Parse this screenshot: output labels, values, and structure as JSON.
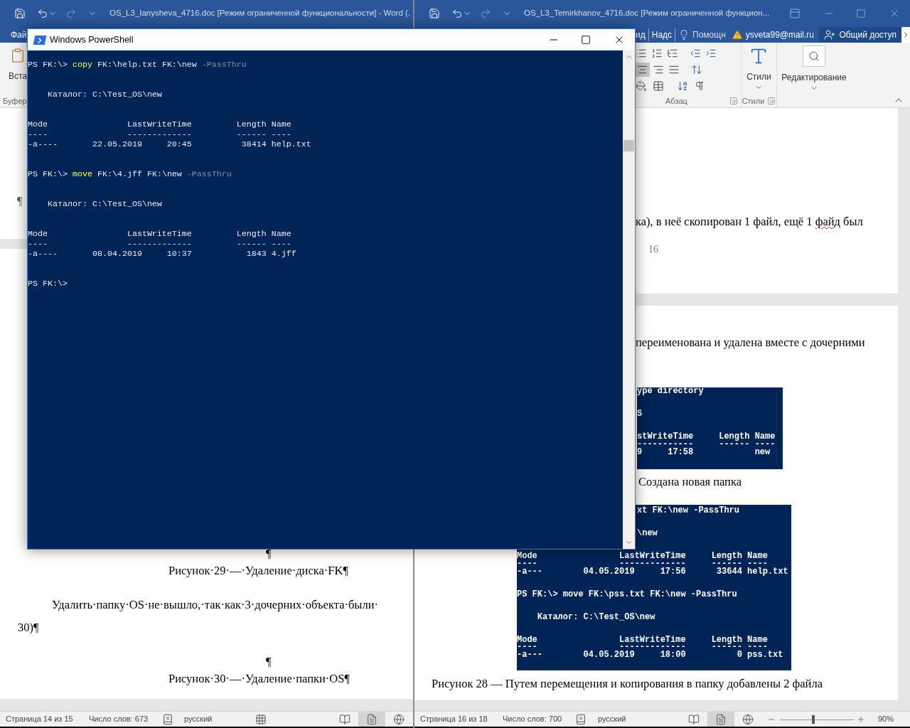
{
  "left_window": {
    "title": "OS_L3_Ianysheva_4716.doc [Режим ограниченной функциональности] - Word (.",
    "tabs": [
      "Фай"
    ],
    "ribbon": {
      "paste_label": "Вста",
      "group_label": "Буфер"
    },
    "page1_mark": "¶",
    "page2": [
      {
        "kind": "mark",
        "text": "¶"
      },
      {
        "kind": "caption",
        "text": "Рисунок·29·—·Удаление·диска·FK¶"
      },
      {
        "kind": "para",
        "text": "Удалить·папку·OS·не·вышло,·так·как·3·дочерних·объекта·были·"
      },
      {
        "kind": "cont",
        "text": "30)¶"
      },
      {
        "kind": "mark",
        "text": "¶"
      },
      {
        "kind": "caption",
        "text": "Рисунок·30·—·Удаление·папки·OS¶"
      }
    ],
    "status": {
      "page": "Страница 14 из 15",
      "words": "Число слов: 673",
      "language": "русский",
      "views": [
        {
          "selected": false
        },
        {
          "selected": true
        },
        {
          "selected": false
        }
      ]
    }
  },
  "right_window": {
    "title": "OS_L3_Temirkhanov_4716.doc [Режим ограниченной функцион...",
    "tabs": [
      {
        "kind": "tab",
        "label": "ид"
      },
      {
        "kind": "tab",
        "label": "Надс"
      },
      {
        "kind": "help",
        "label": "Помощн"
      },
      {
        "kind": "account",
        "label": "ysveta99@mail.ru"
      },
      {
        "kind": "share",
        "label": "Общий доступ"
      }
    ],
    "ribbon": {
      "paragraph_label": "Абзац",
      "styles_button": "Стили",
      "styles_label": "Стили",
      "editing_button": "Редактирование",
      "align": [
        {
          "selected": true
        },
        {
          "selected": false
        },
        {
          "selected": false
        }
      ]
    },
    "page1": {
      "segments": [
        {
          "text": "ка), в неё скопирован 1 файл, ещё 1 ",
          "misspelled": false
        },
        {
          "text": "файд",
          "misspelled": true
        },
        {
          "text": " был",
          "misspelled": false
        }
      ],
      "page_number": "16"
    },
    "page2": {
      "text": "переименована и удалена вместе с дочерними",
      "figure1": [
        {
          "kind": "line",
          "text": "ype directory"
        },
        {
          "kind": "blank"
        },
        {
          "kind": "blank"
        },
        {
          "kind": "line",
          "text": "S"
        },
        {
          "kind": "blank"
        },
        {
          "kind": "blank"
        },
        {
          "kind": "line",
          "text": "stWriteTime     Length Name"
        },
        {
          "kind": "line",
          "text": "-----------     ------ ----"
        },
        {
          "kind": "line",
          "text": "9     17:58            new"
        }
      ],
      "caption1": "Создана новая папка",
      "figure2": [
        {
          "kind": "cut",
          "text": "xt FK:\\new -PassThru"
        },
        {
          "kind": "blank"
        },
        {
          "kind": "blank"
        },
        {
          "kind": "cut",
          "text": "\\new"
        },
        {
          "kind": "blank"
        },
        {
          "kind": "blank"
        },
        {
          "kind": "line",
          "text": "Mode                LastWriteTime     Length Name"
        },
        {
          "kind": "line",
          "text": "----                -------------     ------ ----"
        },
        {
          "kind": "line",
          "text": "-a---        04.05.2019     17:56      33644 help.txt"
        },
        {
          "kind": "blank"
        },
        {
          "kind": "blank"
        },
        {
          "kind": "line",
          "text": "PS FK:\\> move FK:\\pss.txt FK:\\new -PassThru"
        },
        {
          "kind": "blank"
        },
        {
          "kind": "blank"
        },
        {
          "kind": "line",
          "text": "    Каталог: C:\\Test_OS\\new"
        },
        {
          "kind": "blank"
        },
        {
          "kind": "blank"
        },
        {
          "kind": "line",
          "text": "Mode                LastWriteTime     Length Name"
        },
        {
          "kind": "line",
          "text": "----                -------------     ------ ----"
        },
        {
          "kind": "line",
          "text": "-a---        04.05.2019     18:00          0 pss.txt"
        }
      ],
      "caption2": "Рисунок 28 — Путем перемещения и копирования в папку добавлены 2 файла"
    },
    "status": {
      "page": "Страница 16 из 18",
      "words": "Число слов: 700",
      "language": "русский",
      "views": [
        {
          "selected": false
        },
        {
          "selected": true
        },
        {
          "selected": false
        }
      ],
      "zoom": {
        "level": 0.45,
        "reading": "90%"
      }
    }
  },
  "powershell": {
    "title": "Windows PowerShell",
    "lines": [
      {
        "kind": "command",
        "prompt": "PS FK:\\>",
        "verb": "copy",
        "args": "FK:\\help.txt FK:\\new",
        "param": "-PassThru"
      },
      {
        "kind": "blank"
      },
      {
        "kind": "blank"
      },
      {
        "kind": "text",
        "text": "    Каталог: C:\\Test_OS\\new"
      },
      {
        "kind": "blank"
      },
      {
        "kind": "blank"
      },
      {
        "kind": "text",
        "text": "Mode                LastWriteTime         Length Name"
      },
      {
        "kind": "text",
        "text": "----                -------------         ------ ----"
      },
      {
        "kind": "text",
        "text": "-a----       22.05.2019     20:45          38414 help.txt"
      },
      {
        "kind": "blank"
      },
      {
        "kind": "blank"
      },
      {
        "kind": "command",
        "prompt": "PS FK:\\>",
        "verb": "move",
        "args": "FK:\\4.jff FK:\\new",
        "param": "-PassThru"
      },
      {
        "kind": "blank"
      },
      {
        "kind": "blank"
      },
      {
        "kind": "text",
        "text": "    Каталог: C:\\Test_OS\\new"
      },
      {
        "kind": "blank"
      },
      {
        "kind": "blank"
      },
      {
        "kind": "text",
        "text": "Mode                LastWriteTime         Length Name"
      },
      {
        "kind": "text",
        "text": "----                -------------         ------ ----"
      },
      {
        "kind": "text",
        "text": "-a----       08.04.2019     10:37           1843 4.jff"
      },
      {
        "kind": "blank"
      },
      {
        "kind": "blank"
      },
      {
        "kind": "command",
        "prompt": "PS FK:\\>"
      }
    ]
  }
}
